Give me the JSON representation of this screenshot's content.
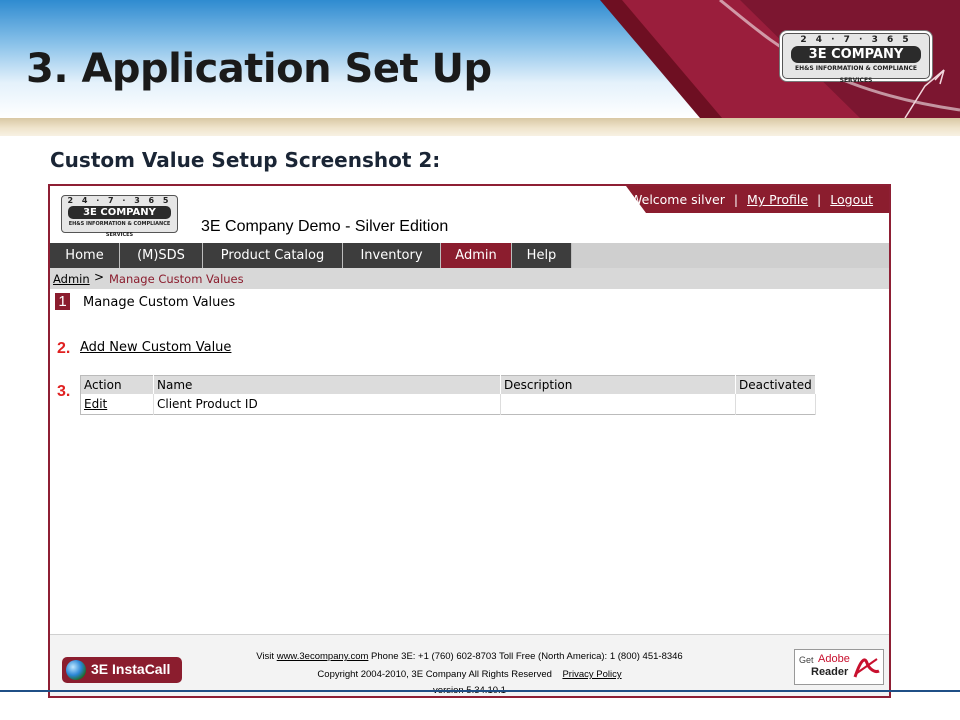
{
  "slide": {
    "title": "3. Application Set Up",
    "subtitle": "Custom Value Setup Screenshot 2:"
  },
  "logo": {
    "digits": "2 4 · 7 · 3 6 5",
    "name": "3E COMPANY",
    "tagline": "EH&S INFORMATION & COMPLIANCE SERVICES"
  },
  "app": {
    "title": "3E Company Demo - Silver Edition",
    "user_bar": {
      "welcome": "Welcome silver",
      "separator": "|",
      "my_profile": "My Profile",
      "logout": "Logout"
    },
    "nav": {
      "tabs": [
        "Home",
        "(M)SDS",
        "Product Catalog",
        "Inventory",
        "Admin",
        "Help"
      ],
      "active": "Admin"
    },
    "breadcrumb": {
      "root": "Admin",
      "arrow": ">",
      "current": "Manage Custom Values"
    },
    "steps": {
      "one": "1",
      "one_text": "Manage Custom Values",
      "two": "2.",
      "add_link": "Add New Custom Value",
      "three": "3."
    },
    "table": {
      "headers": [
        "Action",
        "Name",
        "Description",
        "Deactivated"
      ],
      "rows": [
        [
          "Edit",
          "Client Product ID",
          "",
          ""
        ]
      ]
    },
    "footer": {
      "instacall": "3E InstaCall",
      "visit_prefix": "Visit",
      "site_link": "www.3ecompany.com",
      "phone": "Phone 3E: +1 (760) 602-8703 Toll Free (North America): 1 (800) 451-8346",
      "copyright": "Copyright 2004-2010, 3E Company All Rights Reserved",
      "privacy": "Privacy Policy",
      "version": "version 5.34.10.1",
      "adobe_get": "Get",
      "adobe_brand": "Adobe",
      "adobe_product": "Reader"
    }
  },
  "colors": {
    "accent": "#8b1d2e",
    "step_marker": "#e02020",
    "nav_bg": "#3d3d3d",
    "slide_blue": "#2f8bd0"
  }
}
